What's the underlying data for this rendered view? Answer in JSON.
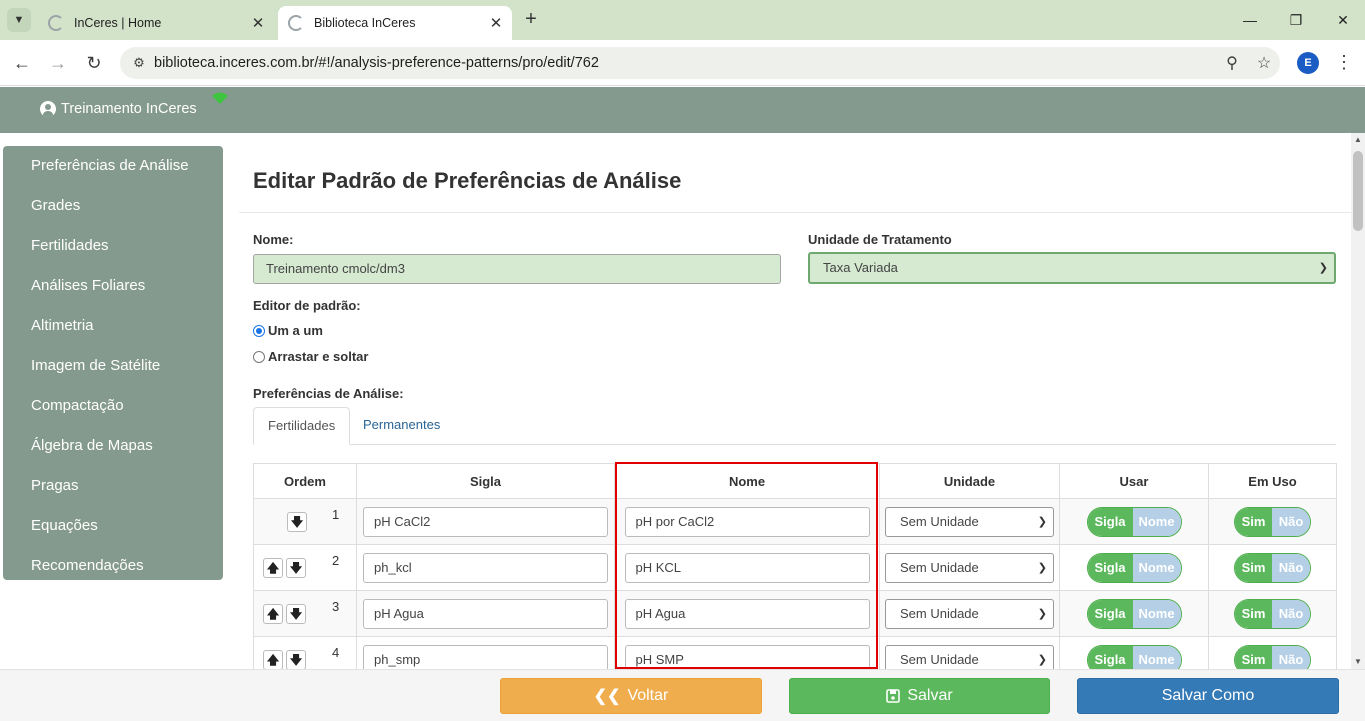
{
  "browser": {
    "tabs": [
      {
        "title": "InCeres | Home",
        "active": false
      },
      {
        "title": "Biblioteca InCeres",
        "active": true
      }
    ],
    "url": "biblioteca.inceres.com.br/#!/analysis-preference-patterns/pro/edit/762",
    "profile_initial": "E"
  },
  "header": {
    "user_name": "Treinamento InCeres"
  },
  "sidebar": {
    "items": [
      "Preferências de Análise",
      "Grades",
      "Fertilidades",
      "Análises Foliares",
      "Altimetria",
      "Imagem de Satélite",
      "Compactação",
      "Álgebra de Mapas",
      "Pragas",
      "Equações",
      "Recomendações"
    ]
  },
  "page": {
    "title": "Editar Padrão de Preferências de Análise",
    "name_label": "Nome:",
    "name_value": "Treinamento cmolc/dm3",
    "unit_label": "Unidade de Tratamento",
    "unit_value": "Taxa Variada",
    "editor_label": "Editor de padrão:",
    "editor_options": [
      {
        "label": "Um a um",
        "checked": true
      },
      {
        "label": "Arrastar e soltar",
        "checked": false
      }
    ],
    "prefs_label": "Preferências de Análise:",
    "tabs": [
      "Fertilidades",
      "Permanentes"
    ]
  },
  "table": {
    "headers": {
      "ordem": "Ordem",
      "sigla": "Sigla",
      "nome": "Nome",
      "unidade": "Unidade",
      "usar": "Usar",
      "em_uso": "Em Uso"
    },
    "rows": [
      {
        "order": "1",
        "sigla": "pH CaCl2",
        "nome": "pH por CaCl2",
        "unidade": "Sem Unidade",
        "usar_on": "Sigla",
        "usar_off": "Nome",
        "emuso_on": "Sim",
        "emuso_off": "Não"
      },
      {
        "order": "2",
        "sigla": "ph_kcl",
        "nome": "pH KCL",
        "unidade": "Sem Unidade",
        "usar_on": "Sigla",
        "usar_off": "Nome",
        "emuso_on": "Sim",
        "emuso_off": "Não"
      },
      {
        "order": "3",
        "sigla": "pH Agua",
        "nome": "pH Agua",
        "unidade": "Sem Unidade",
        "usar_on": "Sigla",
        "usar_off": "Nome",
        "emuso_on": "Sim",
        "emuso_off": "Não"
      },
      {
        "order": "4",
        "sigla": "ph_smp",
        "nome": "pH SMP",
        "unidade": "Sem Unidade",
        "usar_on": "Sigla",
        "usar_off": "Nome",
        "emuso_on": "Sim",
        "emuso_off": "Não"
      }
    ]
  },
  "footer": {
    "back_label": "Voltar",
    "save_label": "Salvar",
    "save_as_label": "Salvar Como"
  },
  "colors": {
    "brand_gray_green": "#859a8e",
    "input_green": "#d6ead2",
    "highlight_red": "#e00000",
    "btn_orange": "#f0ad4e",
    "btn_green": "#5cb85c",
    "btn_blue": "#337ab7"
  }
}
